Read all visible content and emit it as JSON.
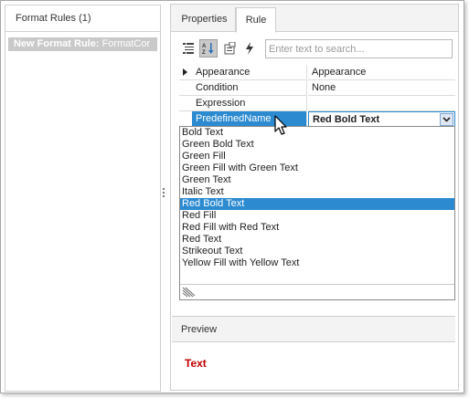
{
  "left": {
    "header": "Format Rules (1)",
    "rule_name_label": "New Format Rule:",
    "rule_name_value": " FormatCor"
  },
  "tabs": {
    "properties": "Properties",
    "rule": "Rule"
  },
  "toolbar": {
    "search_placeholder": "Enter text to search...",
    "buttons": [
      "categorized-icon",
      "alphabetical-icon",
      "property-pages-icon",
      "events-icon"
    ]
  },
  "grid": {
    "rows": [
      {
        "name": "Appearance",
        "value": "Appearance"
      },
      {
        "name": "Condition",
        "value": "None"
      },
      {
        "name": "Expression",
        "value": ""
      },
      {
        "name": "PredefinedName",
        "value": "Red Bold Text"
      }
    ]
  },
  "dropdown": {
    "items": [
      "Bold Text",
      "Green Bold Text",
      "Green Fill",
      "Green Fill with Green Text",
      "Green Text",
      "Italic Text",
      "Red Bold Text",
      "Red Fill",
      "Red Fill with Red Text",
      "Red Text",
      "Strikeout Text",
      "Yellow Fill with Yellow Text"
    ],
    "selected": "Red Bold Text"
  },
  "preview": {
    "header": "Preview",
    "sample": "Text"
  },
  "colors": {
    "selection": "#2b8ad0",
    "preview_text": "#c00000"
  }
}
